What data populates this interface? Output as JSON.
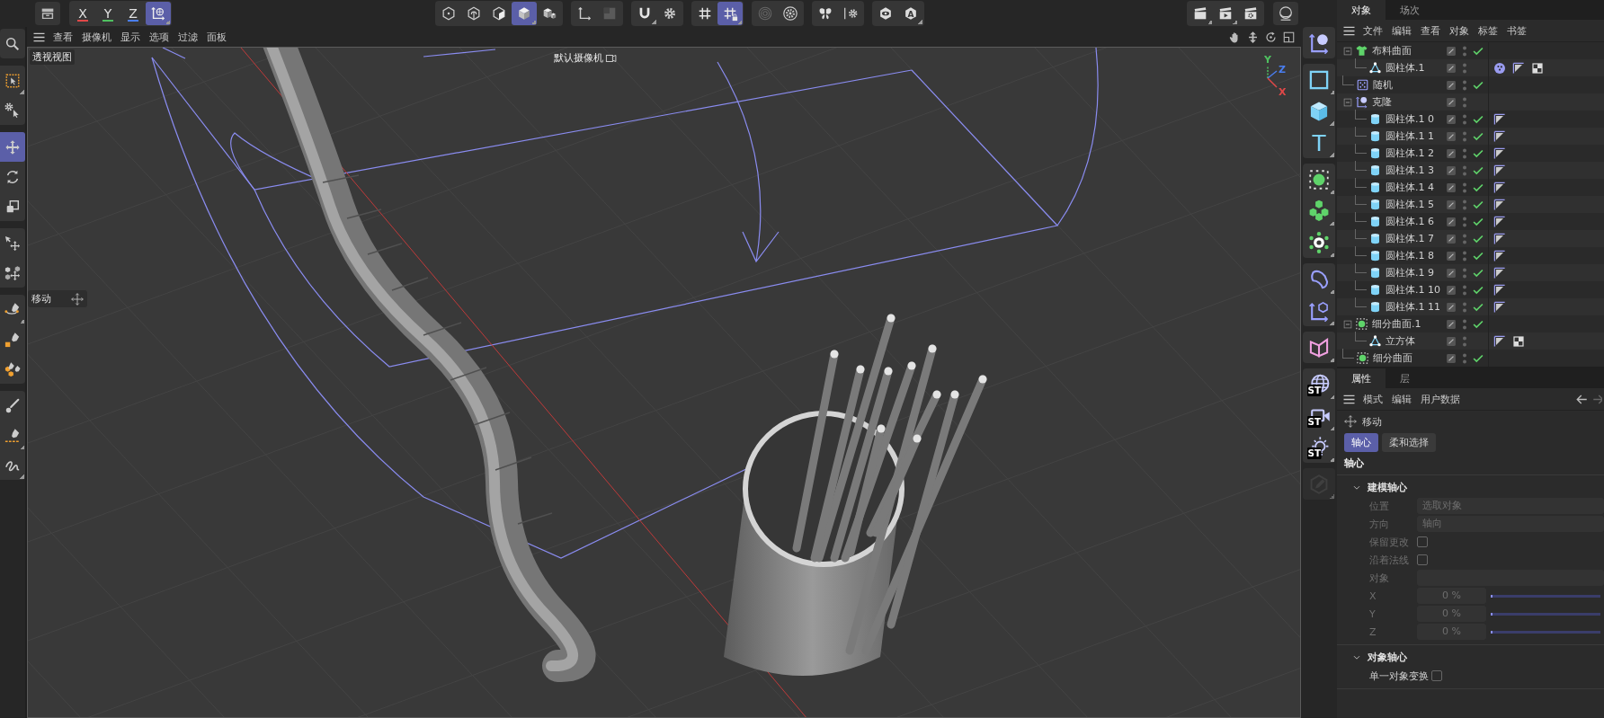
{
  "toolbar": {
    "left": [
      [
        {
          "kind": "panel-toggle",
          "selected": false,
          "menu": false
        }
      ],
      [
        {
          "kind": "axis-lock",
          "label": "X",
          "color": "#e04848",
          "selected": false,
          "menu": false
        },
        {
          "kind": "axis-lock",
          "label": "Y",
          "color": "#4fc060",
          "selected": false,
          "menu": false
        },
        {
          "kind": "axis-lock",
          "label": "Z",
          "color": "#4a7ef0",
          "selected": false,
          "menu": false
        },
        {
          "kind": "coordinate-system",
          "selected": true,
          "menu": true
        }
      ]
    ],
    "center": [
      [
        {
          "kind": "points-mode",
          "selected": false,
          "menu": false
        },
        {
          "kind": "edges-mode",
          "selected": false,
          "menu": false
        },
        {
          "kind": "polygons-mode",
          "selected": false,
          "menu": false
        },
        {
          "kind": "model-mode",
          "selected": true,
          "menu": true
        },
        {
          "kind": "uv-mode",
          "selected": false,
          "menu": false
        }
      ],
      [
        {
          "kind": "axis-mode",
          "selected": false,
          "menu": false
        },
        {
          "kind": "tweak-mode",
          "selected": false,
          "menu": false
        }
      ],
      [
        {
          "kind": "snap",
          "selected": false,
          "menu": true
        },
        {
          "kind": "snap-settings",
          "selected": false,
          "menu": false
        }
      ],
      [
        {
          "kind": "workplane",
          "selected": false,
          "menu": false
        },
        {
          "kind": "workplane-lock",
          "selected": true,
          "menu": true
        }
      ],
      [
        {
          "kind": "solo",
          "selected": false,
          "menu": false
        },
        {
          "kind": "solo-settings",
          "selected": false,
          "menu": false
        }
      ],
      [
        {
          "kind": "symmetry",
          "selected": false,
          "menu": false
        },
        {
          "kind": "symmetry-settings",
          "selected": false,
          "menu": false
        }
      ],
      [
        {
          "kind": "lod",
          "selected": false,
          "menu": false
        },
        {
          "kind": "auto",
          "label": "A",
          "selected": false,
          "menu": true
        }
      ]
    ],
    "right": [
      [
        {
          "kind": "render-view",
          "selected": false,
          "menu": true
        },
        {
          "kind": "render",
          "selected": false,
          "menu": true
        },
        {
          "kind": "render-settings",
          "selected": false,
          "menu": false
        }
      ],
      [
        {
          "kind": "renderer",
          "selected": false,
          "menu": false
        }
      ]
    ]
  },
  "viewport": {
    "menu": [
      "查看",
      "摄像机",
      "显示",
      "选项",
      "过滤",
      "面板"
    ],
    "nav": [
      {
        "kind": "pan"
      },
      {
        "kind": "dolly"
      },
      {
        "kind": "orbit"
      },
      {
        "kind": "layout"
      }
    ],
    "view_name": "透视视图",
    "camera": "默认摄像机",
    "hud": "移动",
    "axes": [
      {
        "label": "Y",
        "color": "#4fc060"
      },
      {
        "label": "Z",
        "color": "#4a7ef0"
      },
      {
        "label": "X",
        "color": "#e04848"
      }
    ]
  },
  "tools": [
    [
      {
        "kind": "search",
        "selected": false,
        "menu": false
      }
    ],
    [
      {
        "kind": "live-select",
        "selected": false,
        "menu": true
      },
      {
        "kind": "select-settings",
        "selected": false,
        "menu": false
      }
    ],
    [
      {
        "kind": "move",
        "selected": true,
        "menu": false
      },
      {
        "kind": "rotate",
        "selected": false,
        "menu": false
      },
      {
        "kind": "scale",
        "selected": false,
        "menu": false
      }
    ],
    [
      {
        "kind": "transform",
        "selected": false,
        "menu": false
      },
      {
        "kind": "place",
        "selected": false,
        "menu": false
      }
    ],
    [
      {
        "kind": "spline-arc",
        "selected": false,
        "menu": true
      },
      {
        "kind": "spline-primitive",
        "selected": false,
        "menu": false
      },
      {
        "kind": "cloner-pen",
        "selected": false,
        "menu": false
      }
    ],
    [
      {
        "kind": "brush",
        "selected": false,
        "menu": false
      },
      {
        "kind": "spline-pen",
        "selected": false,
        "menu": true
      },
      {
        "kind": "sketch",
        "selected": false,
        "menu": true
      }
    ]
  ],
  "palette": [
    [
      {
        "kind": "cloner",
        "menu": false,
        "disabled": false
      }
    ],
    [
      {
        "kind": "spline",
        "menu": true,
        "disabled": false
      },
      {
        "kind": "cube",
        "menu": true,
        "disabled": false
      },
      {
        "kind": "text",
        "label": "T",
        "menu": true,
        "disabled": false
      }
    ],
    [
      {
        "kind": "generator",
        "menu": true,
        "disabled": false
      },
      {
        "kind": "volume",
        "menu": true,
        "disabled": false
      },
      {
        "kind": "field",
        "menu": true,
        "disabled": false
      }
    ],
    [
      {
        "kind": "deformer",
        "menu": true,
        "disabled": false
      },
      {
        "kind": "null",
        "menu": true,
        "disabled": false
      }
    ],
    [
      {
        "kind": "mograph",
        "menu": true,
        "disabled": false
      }
    ],
    [
      {
        "kind": "sky",
        "badge": "ST",
        "menu": true,
        "disabled": false
      },
      {
        "kind": "camera",
        "badge": "ST",
        "menu": true,
        "disabled": false
      },
      {
        "kind": "light",
        "badge": "ST",
        "menu": true,
        "disabled": false
      }
    ],
    [
      {
        "kind": "sculpt",
        "menu": true,
        "disabled": true
      }
    ]
  ],
  "objects": {
    "tabs": [
      {
        "label": "对象",
        "selected": true
      },
      {
        "label": "场次",
        "selected": false
      }
    ],
    "menu": [
      "文件",
      "编辑",
      "查看",
      "对象",
      "标签",
      "书签"
    ],
    "tree": [
      {
        "name": "布料曲面",
        "kind": "cloth",
        "expanded": true,
        "checked": true,
        "children": [
          {
            "name": "圆柱体.1",
            "kind": "polygon",
            "checked": false,
            "tags": [
              {
                "kind": "material"
              },
              {
                "kind": "phong"
              },
              {
                "kind": "texture"
              }
            ]
          }
        ]
      },
      {
        "name": "随机",
        "kind": "effector",
        "checked": true
      },
      {
        "name": "克隆",
        "kind": "cloner",
        "expanded": true,
        "checked": false,
        "children": [
          {
            "name": "圆柱体.1 0",
            "kind": "cylinder",
            "checked": true,
            "tags": [
              {
                "kind": "phong"
              }
            ]
          },
          {
            "name": "圆柱体.1 1",
            "kind": "cylinder",
            "checked": true,
            "tags": [
              {
                "kind": "phong"
              }
            ]
          },
          {
            "name": "圆柱体.1 2",
            "kind": "cylinder",
            "checked": true,
            "tags": [
              {
                "kind": "phong"
              }
            ]
          },
          {
            "name": "圆柱体.1 3",
            "kind": "cylinder",
            "checked": true,
            "tags": [
              {
                "kind": "phong"
              }
            ]
          },
          {
            "name": "圆柱体.1 4",
            "kind": "cylinder",
            "checked": true,
            "tags": [
              {
                "kind": "phong"
              }
            ]
          },
          {
            "name": "圆柱体.1 5",
            "kind": "cylinder",
            "checked": true,
            "tags": [
              {
                "kind": "phong"
              }
            ]
          },
          {
            "name": "圆柱体.1 6",
            "kind": "cylinder",
            "checked": true,
            "tags": [
              {
                "kind": "phong"
              }
            ]
          },
          {
            "name": "圆柱体.1 7",
            "kind": "cylinder",
            "checked": true,
            "tags": [
              {
                "kind": "phong"
              }
            ]
          },
          {
            "name": "圆柱体.1 8",
            "kind": "cylinder",
            "checked": true,
            "tags": [
              {
                "kind": "phong"
              }
            ]
          },
          {
            "name": "圆柱体.1 9",
            "kind": "cylinder",
            "checked": true,
            "tags": [
              {
                "kind": "phong"
              }
            ]
          },
          {
            "name": "圆柱体.1 10",
            "kind": "cylinder",
            "checked": true,
            "tags": [
              {
                "kind": "phong"
              }
            ]
          },
          {
            "name": "圆柱体.1 11",
            "kind": "cylinder",
            "checked": true,
            "tags": [
              {
                "kind": "phong"
              }
            ]
          }
        ]
      },
      {
        "name": "细分曲面.1",
        "kind": "subdivision",
        "expanded": true,
        "checked": true,
        "children": [
          {
            "name": "立方体",
            "kind": "polygon",
            "checked": false,
            "tags": [
              {
                "kind": "phong"
              },
              {
                "kind": "texture"
              }
            ]
          }
        ]
      },
      {
        "name": "细分曲面",
        "kind": "subdivision",
        "checked": true
      }
    ]
  },
  "attributes": {
    "tabs": [
      {
        "label": "属性",
        "selected": true
      },
      {
        "label": "层",
        "selected": false
      }
    ],
    "menu": [
      "模式",
      "编辑",
      "用户数据"
    ],
    "tool": "移动",
    "subtabs": [
      {
        "label": "轴心",
        "selected": true
      },
      {
        "label": "柔和选择",
        "selected": false
      }
    ],
    "heading": "轴心",
    "sections": [
      {
        "title": "建模轴心",
        "expanded": true,
        "params": [
          {
            "kind": "dropdown",
            "label": "位置",
            "value": "选取对象",
            "disabled": true
          },
          {
            "kind": "dropdown",
            "label": "方向",
            "value": "轴向",
            "disabled": true
          },
          {
            "kind": "checkbox",
            "label": "保留更改",
            "checked": false,
            "disabled": true
          },
          {
            "kind": "checkbox",
            "label": "沿着法线",
            "checked": false,
            "disabled": true
          },
          {
            "kind": "link",
            "label": "对象",
            "disabled": true
          },
          {
            "kind": "slider",
            "label": "X",
            "value": "0 %",
            "level": 0,
            "disabled": true
          },
          {
            "kind": "slider",
            "label": "Y",
            "value": "0 %",
            "level": 0,
            "disabled": true
          },
          {
            "kind": "slider",
            "label": "Z",
            "value": "0 %",
            "level": 0,
            "disabled": true
          }
        ]
      },
      {
        "title": "对象轴心",
        "expanded": true,
        "params": [
          {
            "kind": "checkbox",
            "label": "单一对象变换",
            "checked": false,
            "disabled": false
          }
        ]
      }
    ]
  }
}
